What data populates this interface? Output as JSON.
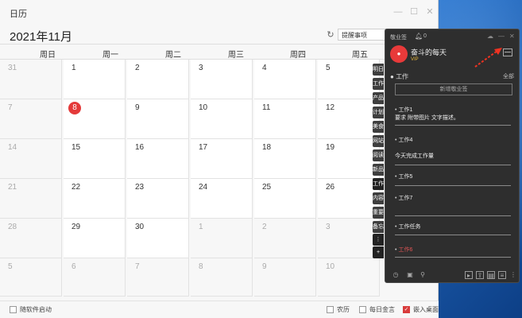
{
  "window": {
    "title": "日历"
  },
  "toolbar": {
    "month_title": "2021年11月",
    "remind_select": "提醒事项"
  },
  "weekdays": [
    "周日",
    "周一",
    "周二",
    "周三",
    "周四",
    "周五"
  ],
  "weeks": [
    [
      "31",
      "1",
      "2",
      "3",
      "4",
      "5"
    ],
    [
      "7",
      "8",
      "9",
      "10",
      "11",
      "12"
    ],
    [
      "14",
      "15",
      "16",
      "17",
      "18",
      "19"
    ],
    [
      "21",
      "22",
      "23",
      "24",
      "25",
      "26"
    ],
    [
      "28",
      "29",
      "30",
      "1",
      "2",
      "3"
    ],
    [
      "5",
      "6",
      "7",
      "8",
      "9",
      "10"
    ]
  ],
  "today": "8",
  "bottom": {
    "startup_label": "随软件启动",
    "lunar_label": "农历",
    "daily_label": "每日金言",
    "embed_label": "嵌入桌面"
  },
  "side_tabs": [
    "明日",
    "工作",
    "产品",
    "计划",
    "美食",
    "网站",
    "阅读",
    "新品",
    "工作",
    "内容",
    "重要",
    "备忘"
  ],
  "sticky": {
    "app_name": "敬业签",
    "bell_count": "0",
    "username": "奋斗的每天",
    "vip": "VIP",
    "category": "工作",
    "all_label": "全部",
    "new_label": "新增敬业签",
    "items": [
      {
        "title": "工作1",
        "desc": "要求 附带图片 文字描述。"
      },
      {
        "title": "工作4",
        "desc": "今天完成工作量"
      },
      {
        "title": "工作5",
        "desc": ""
      },
      {
        "title": "工作7",
        "desc": ""
      },
      {
        "title": "工作任务",
        "desc": ""
      },
      {
        "title": "工作6",
        "desc": ""
      }
    ]
  },
  "colors": {
    "today": "#e43a3a",
    "accent_red": "#e25555",
    "panel": "#2e2e2e"
  }
}
